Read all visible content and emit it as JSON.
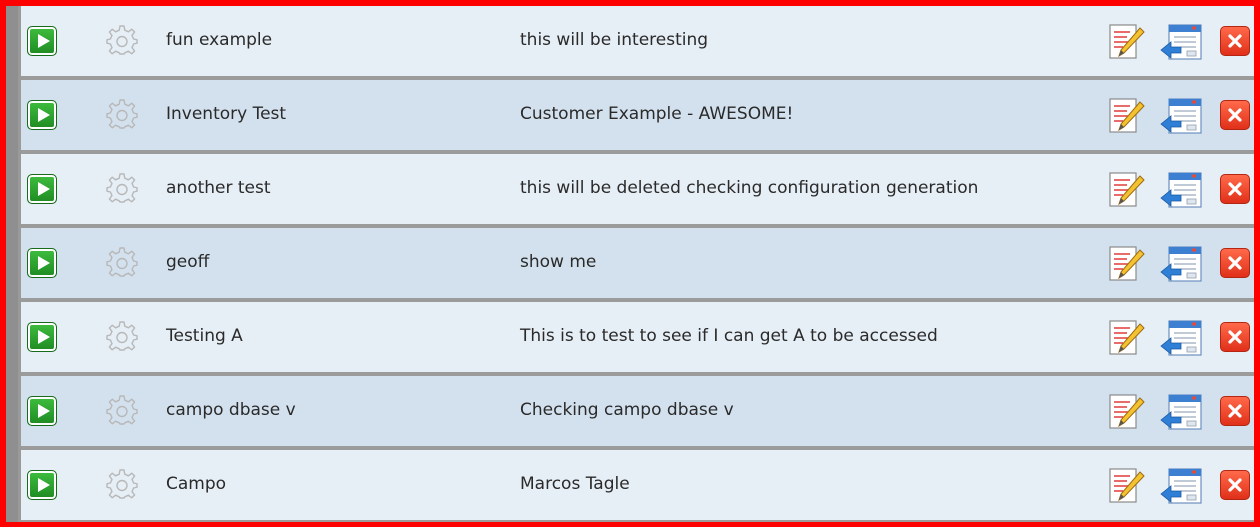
{
  "rows": [
    {
      "name": "fun example",
      "description": "this will be interesting"
    },
    {
      "name": "Inventory Test",
      "description": "Customer Example - AWESOME!"
    },
    {
      "name": "another test",
      "description": "this will be deleted checking configuration generation"
    },
    {
      "name": "geoff",
      "description": "show me"
    },
    {
      "name": "Testing A",
      "description": "This is to test to see if I can get A to be accessed"
    },
    {
      "name": "campo dbase v",
      "description": "Checking campo dbase v"
    },
    {
      "name": "Campo",
      "description": "Marcos Tagle"
    }
  ],
  "icons": {
    "run": "play-icon",
    "settings": "gear-icon",
    "edit": "edit-icon",
    "open": "window-icon",
    "delete": "close-icon"
  },
  "colors": {
    "row_odd": "#e6eef6",
    "row_even": "#d3e1ee",
    "separator": "#9b9b9b",
    "border": "#ff0000",
    "run_green": "#2ea232",
    "delete_red": "#e83a22"
  }
}
